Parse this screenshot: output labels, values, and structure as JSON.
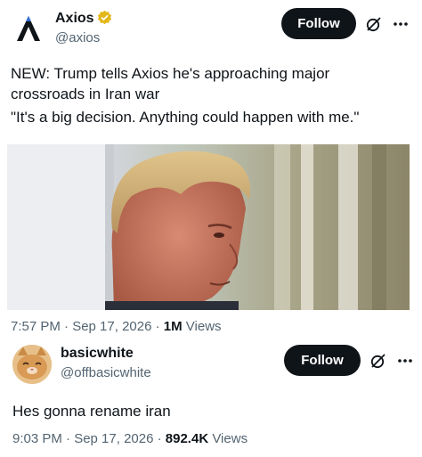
{
  "post": {
    "author_name": "Axios",
    "author_handle": "@axios",
    "follow_label": "Follow",
    "text_line1": "NEW: Trump tells Axios he's approaching major",
    "text_line2": "crossroads in Iran war",
    "text_line3": "\"It's a big decision. Anything could happen with me.\"",
    "timestamp": "7:57 PM · Sep 17, 2026 · ",
    "views_count": "1M",
    "views_label": "Views",
    "media_icon": "photo-of-man-in-profile"
  },
  "reply": {
    "author_name": "basicwhite",
    "author_handle": "@offbasicwhite",
    "follow_label": "Follow",
    "text": "Hes gonna rename iran",
    "timestamp": "9:03 PM · Sep 17, 2026 · ",
    "views_count": "892.4K",
    "views_label": "Views",
    "avatar_icon": "cat-avatar"
  },
  "icons": {
    "verified": "verified-gold-badge",
    "grok": "grok-icon",
    "more": "more-icon"
  },
  "colors": {
    "follow_bg": "#0f1419",
    "secondary_text": "#536471",
    "verified_gold": "#e2b719"
  }
}
